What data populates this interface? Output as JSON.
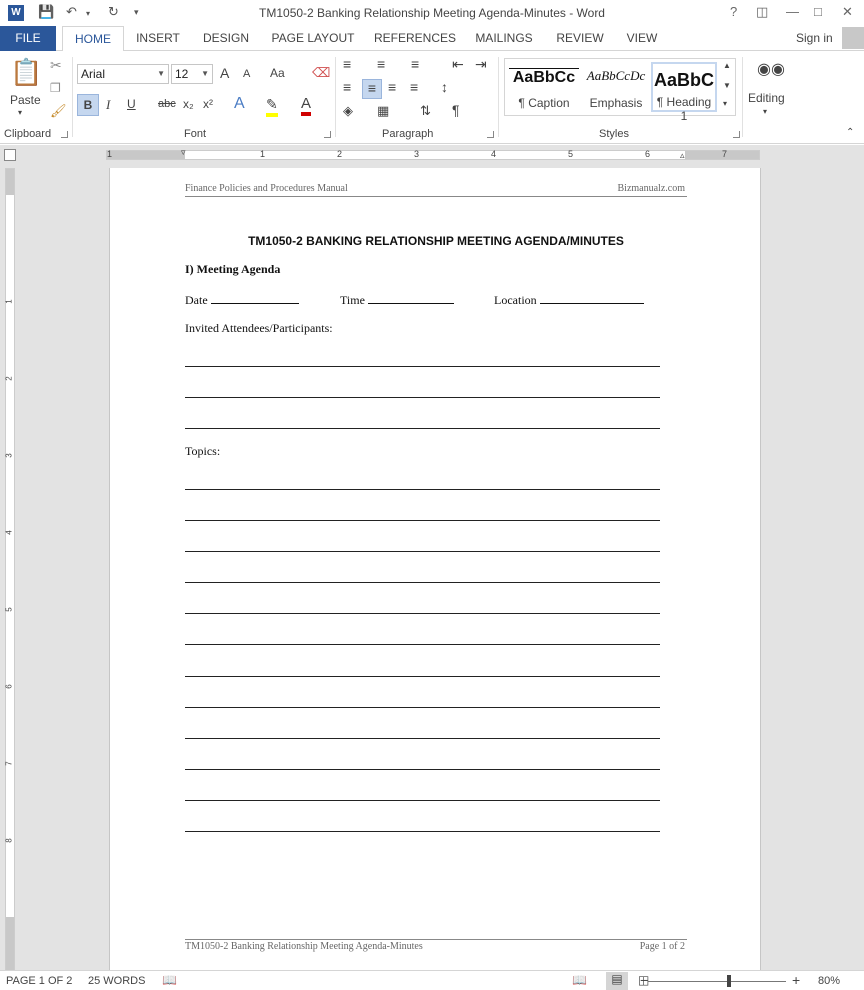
{
  "window": {
    "title": "TM1050-2 Banking Relationship Meeting Agenda-Minutes - Word",
    "app_icon": "W"
  },
  "tabs": [
    "FILE",
    "HOME",
    "INSERT",
    "DESIGN",
    "PAGE LAYOUT",
    "REFERENCES",
    "MAILINGS",
    "REVIEW",
    "VIEW"
  ],
  "account": {
    "signin": "Sign in"
  },
  "ribbon": {
    "clipboard": {
      "label": "Clipboard",
      "paste": "Paste"
    },
    "font": {
      "label": "Font",
      "font_name": "Arial",
      "font_size": "12",
      "bold": "B",
      "italic": "I",
      "underline": "U",
      "strike": "abc",
      "subscript": "x₂",
      "superscript": "x²",
      "grow": "A",
      "shrink": "A",
      "case": "Aa",
      "effects": "A",
      "color": "A"
    },
    "paragraph": {
      "label": "Paragraph",
      "pilcrow": "¶"
    },
    "styles": {
      "label": "Styles",
      "items": [
        {
          "sample": "AaBbCc",
          "name": "¶ Caption"
        },
        {
          "sample": "AaBbCcDc",
          "name": "Emphasis"
        },
        {
          "sample": "AaBbC",
          "name": "¶ Heading 1"
        }
      ]
    },
    "editing": {
      "label": "Editing"
    }
  },
  "ruler": {
    "h_numbers": [
      "1",
      "1",
      "2",
      "3",
      "4",
      "5",
      "6",
      "7"
    ],
    "v_numbers": [
      "1",
      "2",
      "3",
      "4",
      "5",
      "6",
      "7",
      "8"
    ]
  },
  "document": {
    "header_left": "Finance Policies and Procedures Manual",
    "header_right": "Bizmanualz.com",
    "title": "TM1050-2 BANKING RELATIONSHIP MEETING AGENDA/MINUTES",
    "section": "I)  Meeting Agenda",
    "date_label": "Date",
    "time_label": "Time",
    "location_label": "Location",
    "attendees_label": "Invited Attendees/Participants:",
    "topics_label": "Topics:",
    "footer_left": "TM1050-2 Banking Relationship Meeting Agenda-Minutes",
    "footer_right": "Page 1 of 2"
  },
  "status": {
    "page": "PAGE 1 OF 2",
    "words": "25 WORDS",
    "zoom": "80%",
    "zoom_minus": "−",
    "zoom_plus": "+"
  }
}
